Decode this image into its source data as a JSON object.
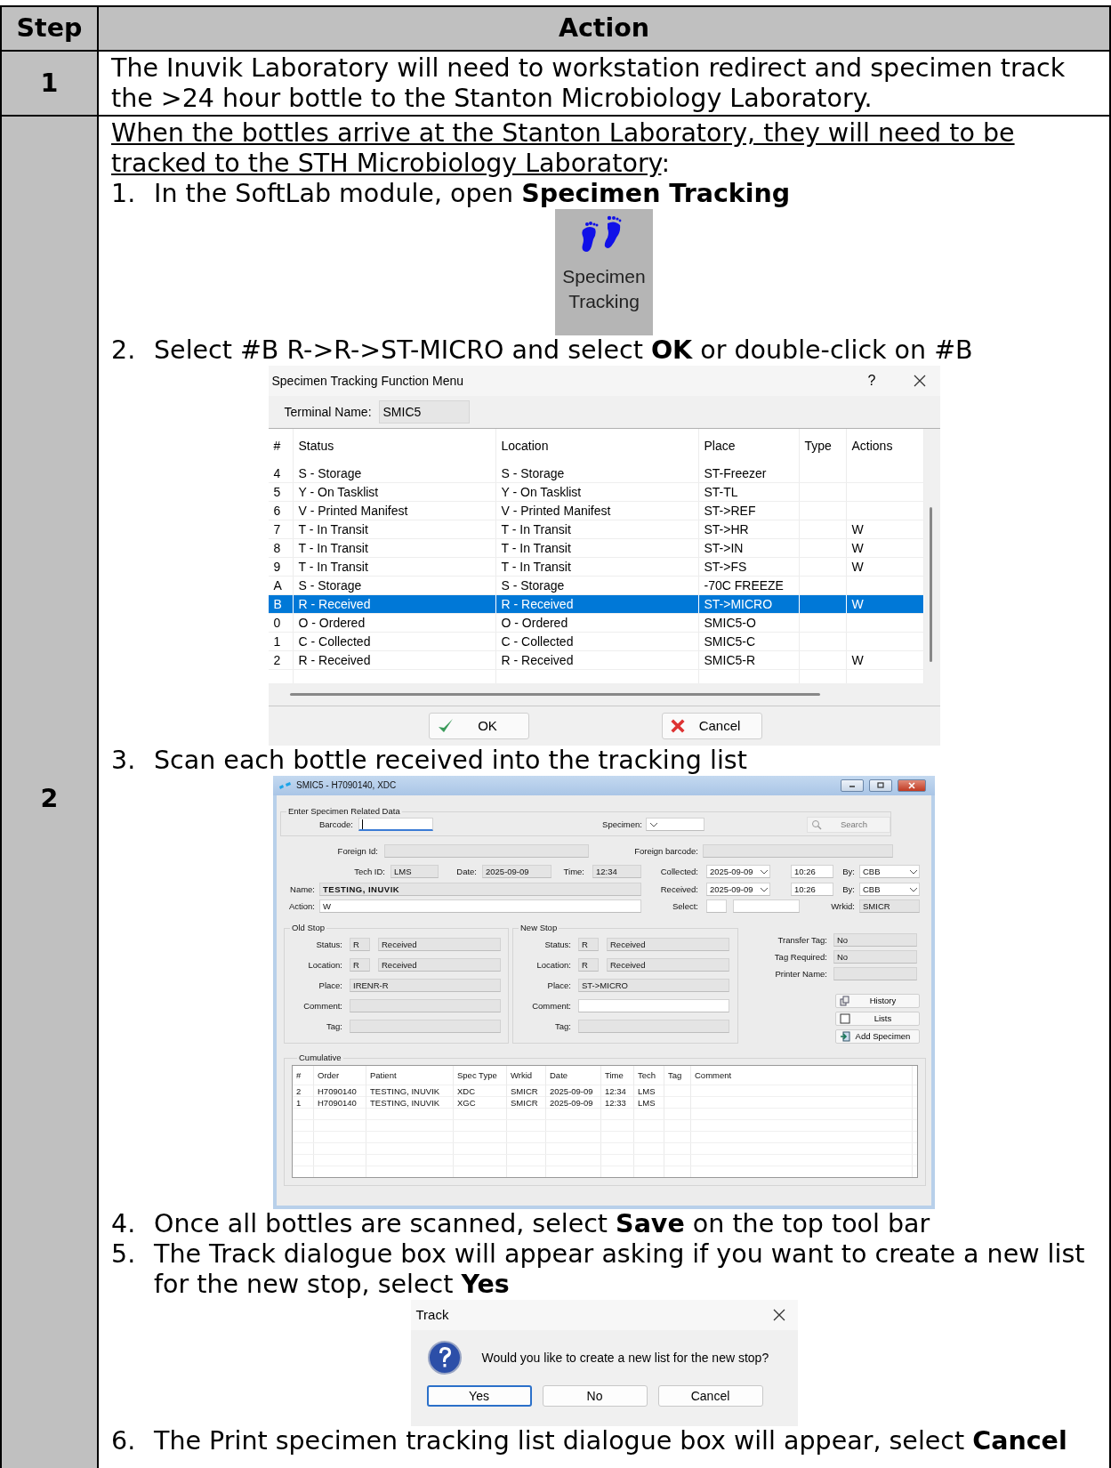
{
  "table": {
    "columns": [
      "Step",
      "Action"
    ],
    "rows": [
      {
        "step": "1",
        "blocks": [
          {
            "kind": "paragraph",
            "text": "The Inuvik Laboratory will need to workstation redirect and specimen track the >24 hour bottle to the Stanton Microbiology Laboratory."
          }
        ]
      },
      {
        "step": "2",
        "blocks": [
          {
            "kind": "heading",
            "text": "When the bottles arrive at the Stanton Laboratory, they will need to be tracked to the STH Microbiology Laboratory",
            "suffix": ":"
          },
          {
            "kind": "step",
            "number": "1.",
            "text": "In the SoftLab module, open **Specimen Tracking**"
          },
          {
            "kind": "tile",
            "label": "Specimen Tracking"
          },
          {
            "kind": "step",
            "number": "2.",
            "text": "Select #B R->R->ST-MICRO and select **OK** or double-click on #B"
          },
          {
            "kind": "menu_dialog",
            "title": "Specimen Tracking Function Menu",
            "help": "?",
            "terminal_label": "Terminal Name:",
            "terminal_value": "SMIC5",
            "columns": [
              "#",
              "Status",
              "Location",
              "Place",
              "Type",
              "Actions"
            ],
            "rows": [
              {
                "num": "4",
                "status": "S - Storage",
                "location": "S - Storage",
                "place": "ST-Freezer",
                "selected": false
              },
              {
                "num": "5",
                "status": "Y - On Tasklist",
                "location": "Y - On Tasklist",
                "place": "ST-TL",
                "selected": false
              },
              {
                "num": "6",
                "status": "V - Printed Manifest",
                "location": "V - Printed Manifest",
                "place": "ST->REF",
                "selected": false
              },
              {
                "num": "7",
                "status": "T - In Transit",
                "location": "T - In Transit",
                "place": "ST->HR",
                "actions": "W",
                "selected": false
              },
              {
                "num": "8",
                "status": "T - In Transit",
                "location": "T - In Transit",
                "place": "ST->IN",
                "actions": "W",
                "selected": false
              },
              {
                "num": "9",
                "status": "T - In Transit",
                "location": "T - In Transit",
                "place": "ST->FS",
                "actions": "W",
                "selected": false
              },
              {
                "num": "A",
                "status": "S - Storage",
                "location": "S - Storage",
                "place": "-70C FREEZE",
                "selected": false
              },
              {
                "num": "B",
                "status": "R - Received",
                "location": "R - Received",
                "place": "ST->MICRO",
                "actions": "W",
                "selected": true
              },
              {
                "num": "0",
                "status": "O - Ordered",
                "location": "O - Ordered",
                "place": "SMIC5-O",
                "selected": false
              },
              {
                "num": "1",
                "status": "C - Collected",
                "location": "C - Collected",
                "place": "SMIC5-C",
                "selected": false
              },
              {
                "num": "2",
                "status": "R - Received",
                "location": "R - Received",
                "place": "SMIC5-R",
                "actions": "W",
                "selected": false
              }
            ],
            "buttons": [
              {
                "label": "OK",
                "kind": "ok"
              },
              {
                "label": "Cancel",
                "kind": "cancel"
              }
            ]
          },
          {
            "kind": "step",
            "number": "3.",
            "text": "Scan each bottle received into the tracking list"
          },
          {
            "kind": "specimen_window",
            "title": "SMIC5 - H7090140, XDC",
            "entry": {
              "title": "Enter Specimen Related Data",
              "barcode_label": "Barcode:",
              "specimen_label": "Specimen:",
              "search": "Search"
            },
            "foreign_id_label": "Foreign Id:",
            "foreign_barcode_label": "Foreign barcode:",
            "tech_id": {
              "label": "Tech ID:",
              "value": "LMS"
            },
            "date": {
              "label": "Date:",
              "value": "2025-09-09"
            },
            "time": {
              "label": "Time:",
              "value": "12:34"
            },
            "collected": {
              "label": "Collected:",
              "date": "2025-09-09",
              "time": "10:26",
              "by_label": "By:",
              "by": "CBB"
            },
            "name": {
              "label": "Name:",
              "value": "TESTING, INUVIK"
            },
            "received": {
              "label": "Received:",
              "date": "2025-09-09",
              "time": "10:26",
              "by_label": "By:",
              "by": "CBB"
            },
            "action": {
              "label": "Action:",
              "value": "W"
            },
            "select_label": "Select:",
            "wrkid": {
              "label": "Wrkid:",
              "value": "SMICR"
            },
            "stops": [
              {
                "title": "Old Stop",
                "status": {
                  "label": "Status:",
                  "code": "R",
                  "text": "Received"
                },
                "location": {
                  "label": "Location:",
                  "code": "R",
                  "text": "Received"
                },
                "place": {
                  "label": "Place:",
                  "value": "IRENR-R"
                },
                "comment_label": "Comment:",
                "tag_label": "Tag:",
                "editable": false
              },
              {
                "title": "New Stop",
                "status": {
                  "label": "Status:",
                  "code": "R",
                  "text": "Received"
                },
                "location": {
                  "label": "Location:",
                  "code": "R",
                  "text": "Received"
                },
                "place": {
                  "label": "Place:",
                  "value": "ST->MICRO"
                },
                "comment_label": "Comment:",
                "tag_label": "Tag:",
                "editable": true
              }
            ],
            "side": {
              "transfer_tag": {
                "label": "Transfer Tag:",
                "value": "No"
              },
              "tag_required": {
                "label": "Tag Required:",
                "value": "No"
              },
              "printer_label": "Printer Name:"
            },
            "buttons": [
              {
                "label": "History",
                "kind": "history"
              },
              {
                "label": "Lists",
                "kind": "lists"
              },
              {
                "label": "Add Specimen",
                "kind": "add"
              }
            ],
            "cumulative": {
              "title": "Cumulative",
              "columns": [
                "#",
                "Order",
                "Patient",
                "Spec Type",
                "Wrkid",
                "Date",
                "Time",
                "Tech",
                "Tag",
                "Comment"
              ],
              "rows": [
                {
                  "cells": [
                    "2",
                    "H7090140",
                    "TESTING, INUVIK",
                    "XDC",
                    "SMICR",
                    "2025-09-09",
                    "12:34",
                    "LMS"
                  ]
                },
                {
                  "cells": [
                    "1",
                    "H7090140",
                    "TESTING, INUVIK",
                    "XGC",
                    "SMICR",
                    "2025-09-09",
                    "12:33",
                    "LMS"
                  ]
                }
              ]
            }
          },
          {
            "kind": "step",
            "number": "4.",
            "text": "Once all bottles are scanned, select **Save** on the top tool bar"
          },
          {
            "kind": "step",
            "number": "5.",
            "text": "The Track dialogue box will appear asking if you want to create a new list for the new stop, select **Yes**"
          },
          {
            "kind": "track_dialog",
            "title": "Track",
            "message": "Would you like to create a new list for the new stop?",
            "buttons": [
              {
                "label": "Yes",
                "focused": true
              },
              {
                "label": "No",
                "focused": false
              },
              {
                "label": "Cancel",
                "focused": false
              }
            ]
          },
          {
            "kind": "step",
            "number": "6.",
            "text": "The Print specimen tracking list dialogue box will appear, select **Cancel**"
          }
        ]
      }
    ]
  }
}
